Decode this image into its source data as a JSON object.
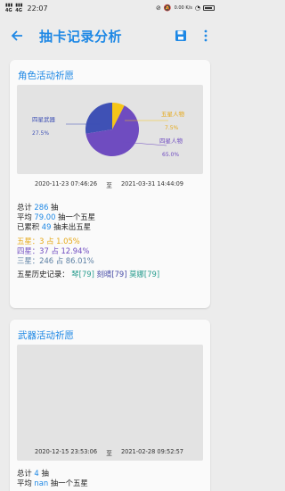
{
  "status": {
    "time": "22:07",
    "sig1": "4G",
    "sig2": "4G",
    "net_speed": "0.00 K/s",
    "battery": ""
  },
  "app_bar": {
    "title": "抽卡记录分析"
  },
  "card1": {
    "title": "角色活动祈愿",
    "chart_data": {
      "type": "pie",
      "categories": [
        "四星武器",
        "五星人物",
        "四星人物"
      ],
      "values": [
        27.5,
        7.5,
        65.0
      ],
      "value_labels": [
        "27.5%",
        "7.5%",
        "65.0%"
      ],
      "colors": [
        "#3f51b5",
        "#f5c518",
        "#6f4cc0"
      ]
    },
    "date_start": "2020-11-23 07:46:26",
    "date_sep": "至",
    "date_end": "2021-03-31 14:44:09",
    "total_label": "总计",
    "total_num": "286",
    "total_unit": "抽",
    "avg_label": "平均",
    "avg_num": "79.00",
    "avg_unit": "抽一个五星",
    "acc_label": "已累积",
    "acc_num": "49",
    "acc_unit": "抽未出五星",
    "five": "五星：3 占 1.05%",
    "four": "四星：37 占 12.94%",
    "three": "三星：246 占 86.01%",
    "history_label": "五星历史记录：",
    "history": [
      "琴[79]",
      "刻晴[79]",
      "莫娜[79]"
    ]
  },
  "card2": {
    "title": "武器活动祈愿",
    "date_start": "2020-12-15 23:53:06",
    "date_sep": "至",
    "date_end": "2021-02-28 09:52:57",
    "total_label": "总计",
    "total_num": "4",
    "total_unit": "抽",
    "avg_label": "平均",
    "avg_num": "nan",
    "avg_unit": "抽一个五星"
  }
}
